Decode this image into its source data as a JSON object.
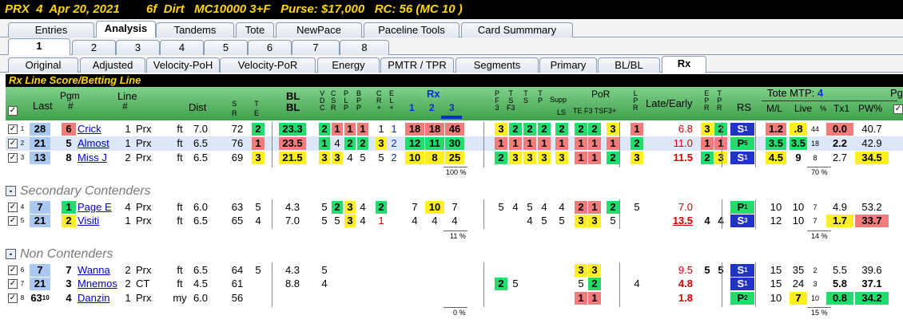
{
  "title": {
    "track": "PRX",
    "race": "4",
    "date": "Apr 20, 2021",
    "distance": "6f",
    "surface": "Dirt",
    "class": "MC10000 3+F",
    "purse": "Purse: $17,000",
    "rc": "RC: 56",
    "mc": "(MC 10 )"
  },
  "tabs1": [
    "Entries",
    "Analysis",
    "Tandems",
    "Tote",
    "NewPace",
    "Paceline Tools",
    "Card Summmary"
  ],
  "tabs2": [
    "1",
    "2",
    "3",
    "4",
    "5",
    "6",
    "7",
    "8"
  ],
  "tabs3": [
    "Original",
    "Adjusted",
    "Velocity-PoH",
    "Velocity-PoR",
    "Energy",
    "PMTR / TPR",
    "Segments",
    "Primary",
    "BL/BL",
    "Rx"
  ],
  "section_title": "Rx Line Score/Betting Line",
  "headers": {
    "last": "Last",
    "pgm": "Pgm",
    "pgm_hash": "#",
    "line": "Line",
    "line_hash": "#",
    "dist": "Dist",
    "sr": "S\nR",
    "te": "T\nE",
    "bl1": "BL",
    "bl2": "BL",
    "vdc": "V\nD\nC",
    "csr": "C\nS\nR",
    "plp": "P\nL\nP",
    "bpp": "B\nP\nP",
    "cr": "C\nR\n+",
    "el": "E\nL\n+",
    "rx": "Rx",
    "rx1": "1",
    "rx2": "2",
    "rx3": "3",
    "pfs": "P\nF\n3",
    "tsf3": "T\nS\nF3",
    "ts": "T\nS",
    "tp": "T\nP",
    "supp": "Supp",
    "ls": "LS",
    "por": "PoR",
    "por_sub": "TE F3 TSF3+",
    "lpr": "L\nP\nR",
    "late_early": "Late/Early",
    "epr": "E\nP\nR",
    "tpr": "T\nP\nR",
    "rs": "RS",
    "tote": "Tote MTP:",
    "tote_mtp": "4",
    "pg": "Pg",
    "ml": "M/L",
    "live": "Live",
    "live_pct": "%",
    "tx1": "Tx1",
    "pw": "PW%"
  },
  "groups": {
    "secondary": "Secondary Contenders",
    "non": "Non Contenders"
  },
  "pcts": {
    "g1": "100 %",
    "g1b": "70 %",
    "g2": "11 %",
    "g2b": "14 %",
    "g3": "0 %",
    "g3b": "15 %"
  },
  "rows": [
    {
      "n": "1",
      "last": "28",
      "pgm": "6",
      "name": "Crick",
      "line": "1",
      "trk": "Prx",
      "surf": "ft",
      "dist": "7.0",
      "sr": "72",
      "te": "2",
      "bl": "23.3",
      "v": "2",
      "c": "1",
      "p": "1",
      "b": "1",
      "cr": "1",
      "el": "1",
      "rx1": "18",
      "rx2": "18",
      "rx3": "46",
      "pf": "3",
      "tsf": "2",
      "ts": "2",
      "tp": "2",
      "ls": "2",
      "p1": "2",
      "p2": "2",
      "p3": "3",
      "lpr": "1",
      "le": "6.8",
      "epr": "3",
      "tpr": "2",
      "rs": "S",
      "rss": "1",
      "ml": "1.2",
      "live": ".8",
      "lp": "44",
      "tx": "0.0",
      "pw": "40.7"
    },
    {
      "n": "2",
      "last": "21",
      "pgm": "5",
      "name": "Almost",
      "line": "1",
      "trk": "Prx",
      "surf": "ft",
      "dist": "6.5",
      "sr": "76",
      "te": "1",
      "bl": "23.5",
      "v": "1",
      "c": "4",
      "p": "2",
      "b": "2",
      "cr": "3",
      "el": "2",
      "rx1": "12",
      "rx2": "11",
      "rx3": "30",
      "pf": "1",
      "tsf": "1",
      "ts": "1",
      "tp": "1",
      "ls": "1",
      "p1": "1",
      "p2": "1",
      "p3": "1",
      "lpr": "2",
      "le": "11.0",
      "epr": "1",
      "tpr": "1",
      "rs": "P",
      "rss": "5",
      "ml": "3.5",
      "live": "3.5",
      "lp": "18",
      "tx": "2.2",
      "pw": "42.9"
    },
    {
      "n": "3",
      "last": "13",
      "pgm": "8",
      "name": "Miss J",
      "line": "2",
      "trk": "Prx",
      "surf": "ft",
      "dist": "6.5",
      "sr": "69",
      "te": "3",
      "bl": "21.5",
      "v": "3",
      "c": "3",
      "p": "4",
      "b": "5",
      "cr": "5",
      "el": "2",
      "rx1": "10",
      "rx2": "8",
      "rx3": "25",
      "pf": "2",
      "tsf": "3",
      "ts": "3",
      "tp": "3",
      "ls": "3",
      "p1": "1",
      "p2": "1",
      "p3": "2",
      "lpr": "3",
      "le": "11.5",
      "epr": "2",
      "tpr": "3",
      "rs": "S",
      "rss": "1",
      "ml": "4.5",
      "live": "9",
      "lp": "8",
      "tx": "2.7",
      "pw": "34.5"
    },
    {
      "n": "4",
      "last": "7",
      "pgm": "1",
      "name": "Page E",
      "line": "4",
      "trk": "Prx",
      "surf": "ft",
      "dist": "6.0",
      "sr": "63",
      "te": "5",
      "bl": "4.3",
      "v": "5",
      "c": "2",
      "p": "3",
      "b": "4",
      "cr": "2",
      "el": "",
      "rx1": "7",
      "rx2": "10",
      "rx3": "7",
      "pf": "5",
      "tsf": "4",
      "ts": "5",
      "tp": "4",
      "ls": "4",
      "p1": "2",
      "p2": "1",
      "p3": "2",
      "lpr": "5",
      "le": "7.0",
      "epr": "",
      "tpr": "",
      "rs": "P",
      "rss": "1",
      "ml": "10",
      "live": "10",
      "lp": "7",
      "tx": "4.9",
      "pw": "53.2"
    },
    {
      "n": "5",
      "last": "21",
      "pgm": "2",
      "name": "Visiti",
      "line": "1",
      "trk": "Prx",
      "surf": "ft",
      "dist": "6.5",
      "sr": "65",
      "te": "4",
      "bl": "7.0",
      "v": "5",
      "c": "5",
      "p": "3",
      "b": "4",
      "cr": "1",
      "el": "",
      "rx1": "4",
      "rx2": "4",
      "rx3": "4",
      "pf": "",
      "tsf": "",
      "ts": "4",
      "tp": "5",
      "ls": "5",
      "p1": "3",
      "p2": "3",
      "p3": "5",
      "lpr": "",
      "le": "13.5",
      "epr": "4",
      "tpr": "4",
      "rs": "S",
      "rss": "3",
      "ml": "12",
      "live": "10",
      "lp": "7",
      "tx": "1.7",
      "pw": "33.7"
    },
    {
      "n": "6",
      "last": "7",
      "pgm": "7",
      "name": "Wanna",
      "line": "2",
      "trk": "Prx",
      "surf": "ft",
      "dist": "6.5",
      "sr": "64",
      "te": "5",
      "bl": "4.3",
      "v": "5",
      "p1": "3",
      "p2": "3",
      "le": "9.5",
      "epr": "5",
      "tpr": "5",
      "rs": "S",
      "rss": "1",
      "ml": "15",
      "live": "35",
      "lp": "2",
      "tx": "5.5",
      "pw": "39.6"
    },
    {
      "n": "7",
      "last": "21",
      "pgm": "3",
      "name": "Mnemos",
      "line": "2",
      "trk": "CT",
      "surf": "ft",
      "dist": "4.5",
      "sr": "61",
      "bl": "8.8",
      "v": "4",
      "pf": "2",
      "tsf": "5",
      "p1": "5",
      "p2": "2",
      "lpr": "4",
      "le": "4.8",
      "rs": "S",
      "rss": "1",
      "ml": "15",
      "live": "24",
      "lp": "3",
      "tx": "5.8",
      "pw": "37.1"
    },
    {
      "n": "8",
      "last": "63",
      "lastsup": "10",
      "pgm": "4",
      "name": "Danzin",
      "line": "1",
      "trk": "Prx",
      "surf": "my",
      "dist": "6.0",
      "sr": "56",
      "p1": "1",
      "p2": "1",
      "le": "1.8",
      "rs": "P",
      "rss": "2",
      "ml": "10",
      "live": "7",
      "lp": "10",
      "tx": "0.8",
      "pw": "34.2"
    }
  ],
  "colors": {
    "green": "#22dd6e",
    "yellow": "#ffee22",
    "red": "#f07c7c",
    "blue": "#2233cc",
    "title_fg": "#ffd600"
  }
}
